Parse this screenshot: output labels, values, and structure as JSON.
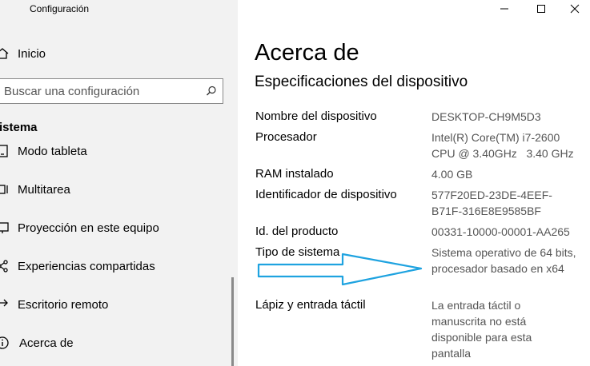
{
  "window": {
    "title": "Configuración"
  },
  "sidebar": {
    "home_label": "Inicio",
    "search_placeholder": "Buscar una configuración",
    "section_heading": "istema",
    "items": [
      {
        "label": "Modo tableta",
        "icon": "tablet-mode-icon"
      },
      {
        "label": "Multitarea",
        "icon": "multitasking-icon"
      },
      {
        "label": "Proyección en este equipo",
        "icon": "projection-icon"
      },
      {
        "label": "Experiencias compartidas",
        "icon": "shared-experiences-icon"
      },
      {
        "label": "Escritorio remoto",
        "icon": "remote-desktop-icon"
      },
      {
        "label": "Acerca de",
        "icon": "about-icon"
      }
    ]
  },
  "main": {
    "title": "Acerca de",
    "section_title": "Especificaciones del dispositivo",
    "specs": [
      {
        "label": "Nombre del dispositivo",
        "value": "DESKTOP-CH9M5D3"
      },
      {
        "label": "Procesador",
        "value": "Intel(R) Core(TM) i7-2600 CPU @ 3.40GHz   3.40 GHz"
      },
      {
        "label": "RAM instalado",
        "value": "4.00 GB"
      },
      {
        "label": "Identificador de dispositivo",
        "value": "577F20ED-23DE-4EEF-B71F-316E8E9585BF"
      },
      {
        "label": "Id. del producto",
        "value": "00331-10000-00001-AA265"
      },
      {
        "label": "Tipo de sistema",
        "value": "Sistema operativo de 64 bits, procesador basado en x64"
      },
      {
        "label": "Lápiz y entrada táctil",
        "value": "La entrada táctil o manuscrita no está disponible para esta pantalla"
      }
    ]
  },
  "colors": {
    "sidebar_bg": "#f2f2f2",
    "value_text": "#555555",
    "arrow": "#1fa3e0"
  }
}
